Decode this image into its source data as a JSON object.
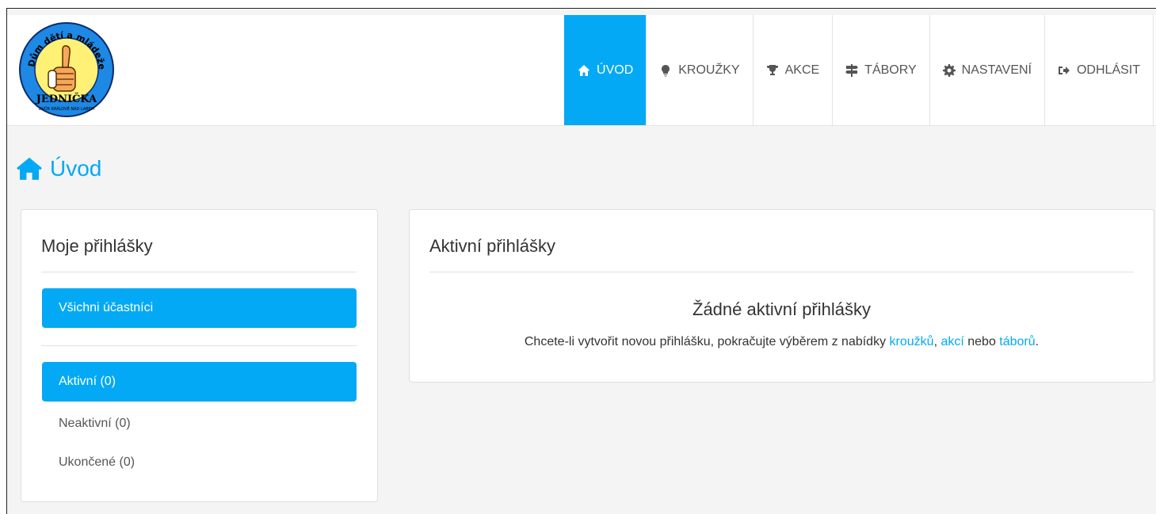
{
  "brand": {
    "logo_text_top": "Dům dětí a mládeže",
    "logo_text_main": "JEDNIČKA",
    "logo_text_bottom": "DVŮR KRÁLOVÉ NAD LABEM"
  },
  "nav": {
    "items": [
      {
        "label": "ÚVOD",
        "icon": "home-icon",
        "active": true
      },
      {
        "label": "KROUŽKY",
        "icon": "lightbulb-icon",
        "active": false
      },
      {
        "label": "AKCE",
        "icon": "trophy-icon",
        "active": false
      },
      {
        "label": "TÁBORY",
        "icon": "signpost-icon",
        "active": false
      },
      {
        "label": "NASTAVENÍ",
        "icon": "gear-icon",
        "active": false
      },
      {
        "label": "ODHLÁSIT",
        "icon": "logout-icon",
        "active": false
      }
    ]
  },
  "page": {
    "title": "Úvod"
  },
  "sidebar": {
    "title": "Moje přihlášky",
    "participants_filter": "Všichni účastníci",
    "items": [
      {
        "label": "Aktivní (0)",
        "active": true
      },
      {
        "label": "Neaktivní (0)",
        "active": false
      },
      {
        "label": "Ukončené (0)",
        "active": false
      }
    ]
  },
  "main": {
    "title": "Aktivní přihlášky",
    "empty_title": "Žádné aktivní přihlášky",
    "empty_text_prefix": "Chcete-li vytvořit novou přihlášku, pokračujte výběrem z nabídky ",
    "link_krouzku": "kroužků",
    "sep1": ", ",
    "link_akci": "akcí",
    "sep2": " nebo ",
    "link_taboru": "táborů",
    "suffix": "."
  },
  "colors": {
    "accent": "#03a9f4",
    "logo_ring": "#1e88e5",
    "logo_fill": "#fff176"
  }
}
